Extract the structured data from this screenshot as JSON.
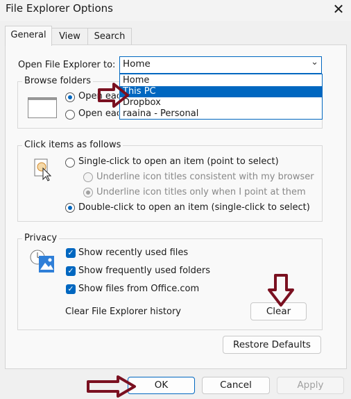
{
  "window": {
    "title": "File Explorer Options",
    "close_glyph": "✕"
  },
  "tabs": [
    {
      "label": "General"
    },
    {
      "label": "View"
    },
    {
      "label": "Search"
    }
  ],
  "open_to": {
    "label": "Open File Explorer to:",
    "value": "Home",
    "options": [
      "Home",
      "This PC",
      "Dropbox",
      "raaina - Personal"
    ],
    "highlighted": "This PC"
  },
  "browse_folders": {
    "title": "Browse folders",
    "opt1": "Open each folder in the same window",
    "opt2": "Open each folder in its own window"
  },
  "click_items": {
    "title": "Click items as follows",
    "single": "Single-click to open an item (point to select)",
    "underline_browser": "Underline icon titles consistent with my browser",
    "underline_point": "Underline icon titles only when I point at them",
    "double": "Double-click to open an item (single-click to select)"
  },
  "privacy": {
    "title": "Privacy",
    "recent_files": "Show recently used files",
    "frequent_folders": "Show frequently used folders",
    "office_files": "Show files from Office.com",
    "clear_label": "Clear File Explorer history",
    "clear_button": "Clear"
  },
  "restore_defaults": "Restore Defaults",
  "footer": {
    "ok": "OK",
    "cancel": "Cancel",
    "apply": "Apply"
  },
  "colors": {
    "accent": "#0067c0",
    "annotation_arrow": "#7a1020"
  }
}
